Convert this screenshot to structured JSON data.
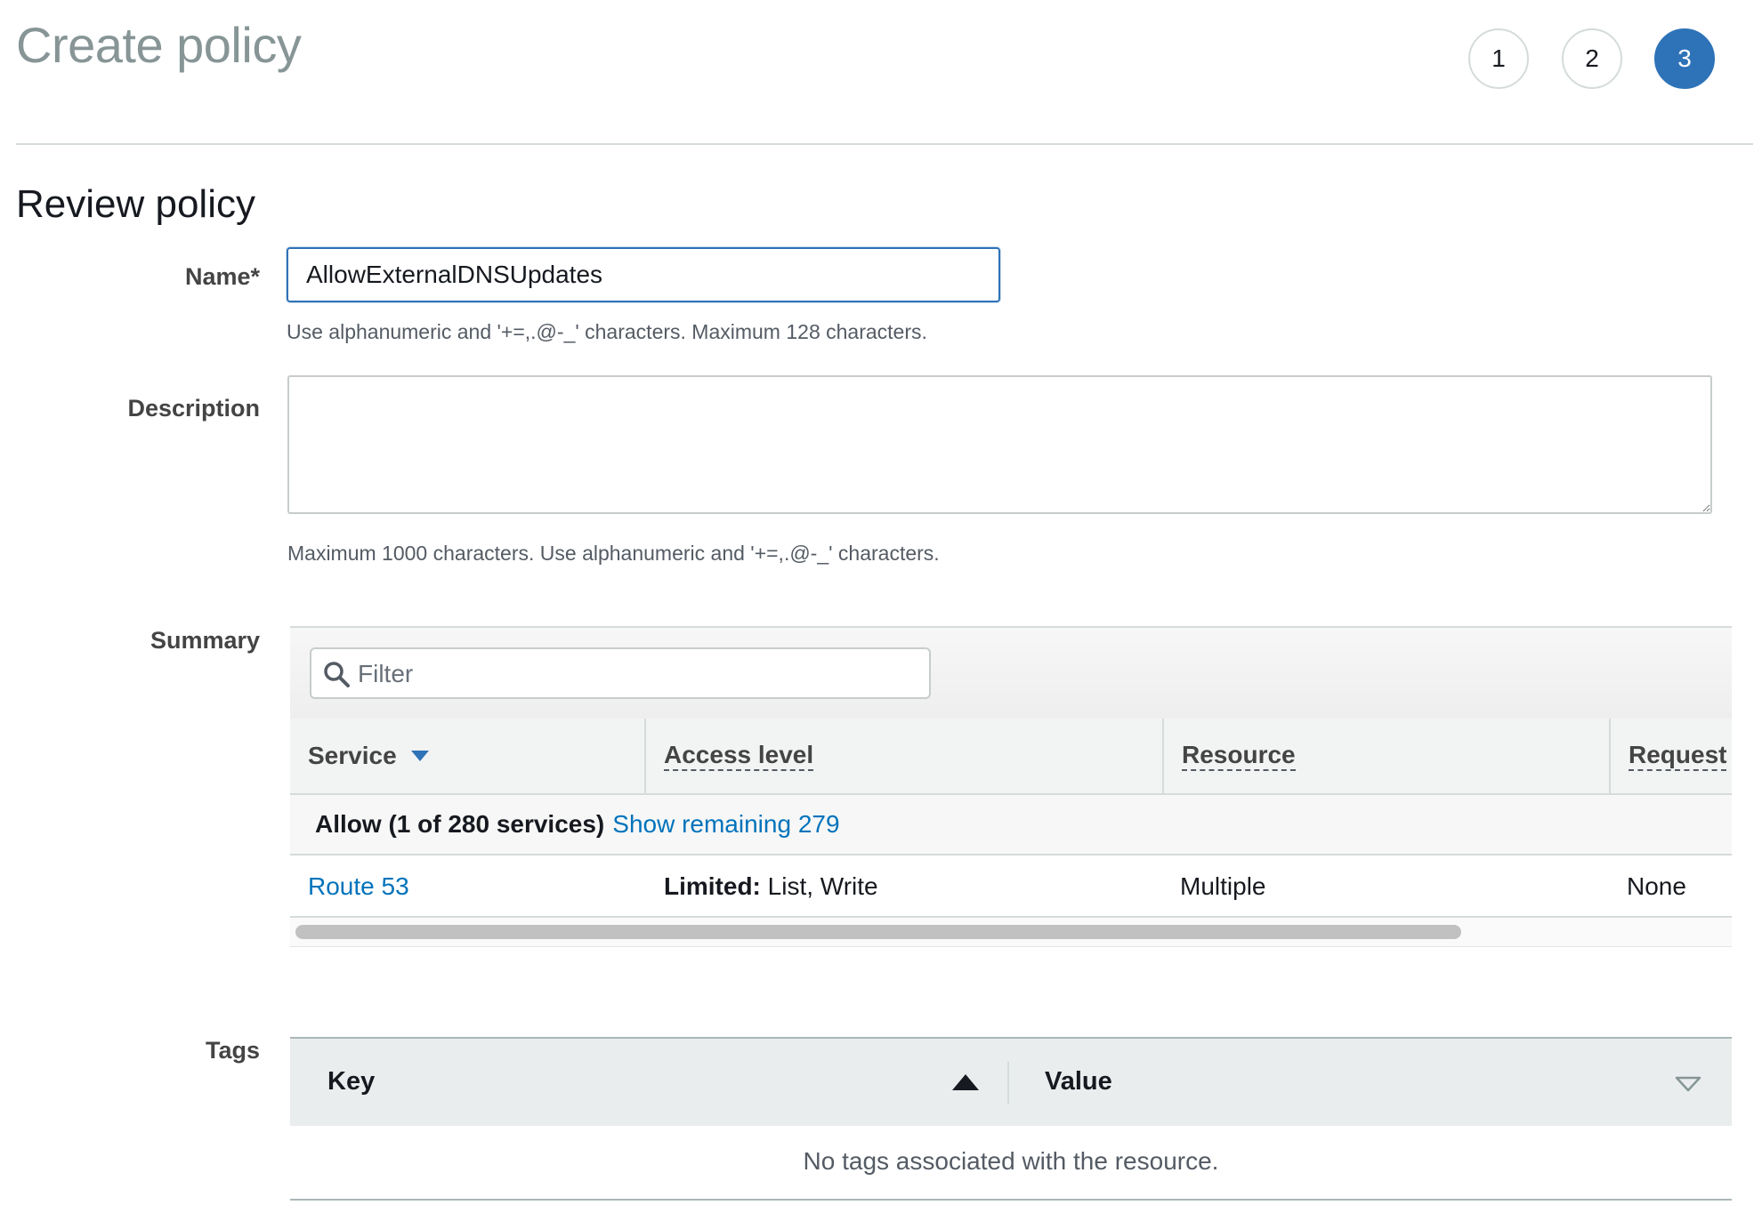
{
  "header": {
    "title": "Create policy",
    "steps": [
      {
        "label": "1",
        "active": false
      },
      {
        "label": "2",
        "active": false
      },
      {
        "label": "3",
        "active": true
      }
    ]
  },
  "section": {
    "title": "Review policy"
  },
  "name_field": {
    "label": "Name*",
    "value": "AllowExternalDNSUpdates",
    "hint": "Use alphanumeric and '+=,.@-_' characters. Maximum 128 characters."
  },
  "description_field": {
    "label": "Description",
    "value": "",
    "hint": "Maximum 1000 characters. Use alphanumeric and '+=,.@-_' characters."
  },
  "summary": {
    "label": "Summary",
    "filter_placeholder": "Filter",
    "columns": [
      "Service",
      "Access level",
      "Resource",
      "Request"
    ],
    "group": {
      "label": "Allow (1 of 280 services)",
      "link": "Show remaining 279"
    },
    "rows": [
      {
        "service": "Route 53",
        "access_prefix": "Limited:",
        "access_rest": " List, Write",
        "resource": "Multiple",
        "request": "None"
      }
    ]
  },
  "tags": {
    "label": "Tags",
    "columns": [
      "Key",
      "Value"
    ],
    "empty_text": "No tags associated with the resource."
  },
  "colors": {
    "accent": "#2e73b8",
    "link": "#0073bb",
    "border": "#d5dbdb"
  }
}
